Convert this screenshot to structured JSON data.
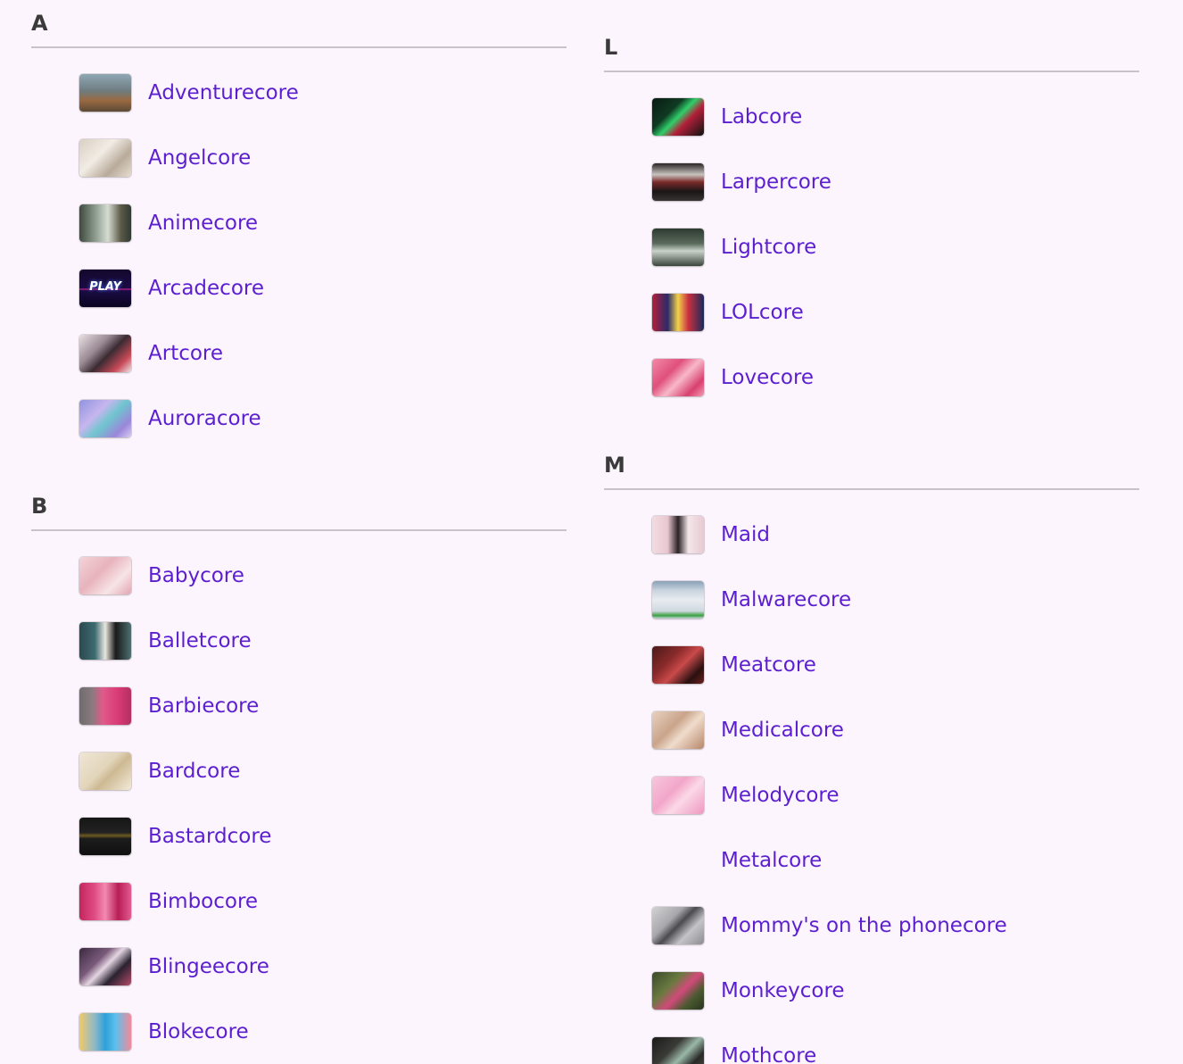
{
  "sections": {
    "A": {
      "letter": "A",
      "items": [
        {
          "label": "Adventurecore",
          "thumb": "linear-gradient(180deg,#8fa7b4 0%,#6e7c80 45%,#9a6a42 70%,#5c4a36 100%)"
        },
        {
          "label": "Angelcore",
          "thumb": "linear-gradient(135deg,#d9cfc3 0%,#f1ece4 40%,#b9ab9b 70%,#e6ddd0 100%)"
        },
        {
          "label": "Animecore",
          "thumb": "linear-gradient(90deg,#3f4a3d 0%,#8a9a8c 30%,#d6dcd2 55%,#5c5a48 80%,#2f3a33 100%)"
        },
        {
          "label": "Arcadecore",
          "thumb": "linear-gradient(180deg,#14082c 0%,#1a0c44 50%,#c0208a 52%,#1a0c44 56%,#0a0520 100%)",
          "overlay": "PLAY"
        },
        {
          "label": "Artcore",
          "thumb": "linear-gradient(135deg,#e9e1e3 0%,#9a8a93 35%,#3a2b33 55%,#c84a58 80%,#efe6e8 100%)"
        },
        {
          "label": "Auroracore",
          "thumb": "linear-gradient(135deg,#8f93e0 0%,#c7b6ee 35%,#6fc5cf 55%,#9b86d9 80%,#d7cdf3 100%)"
        }
      ]
    },
    "B": {
      "letter": "B",
      "items": [
        {
          "label": "Babycore",
          "thumb": "linear-gradient(135deg,#f3d4d8 0%,#e8b3bd 40%,#f7e4e6 70%,#e2a6b2 100%)"
        },
        {
          "label": "Balletcore",
          "thumb": "linear-gradient(90deg,#2a4a50 0%,#3c6b70 30%,#e9e6df 50%,#1a1a1a 70%,#4d6f72 100%)"
        },
        {
          "label": "Barbiecore",
          "thumb": "linear-gradient(90deg,#6d6d6d 0%,#8a7a80 25%,#e05a8a 45%,#d93a75 75%,#b23063 100%)"
        },
        {
          "label": "Bardcore",
          "thumb": "linear-gradient(135deg,#efe6d4 0%,#e2d5bb 45%,#cdb992 60%,#f2ead9 100%)"
        },
        {
          "label": "Bastardcore",
          "thumb": "linear-gradient(180deg,#161616 0%,#222222 40%,#6b5a20 48%,#1c1c1c 56%,#101010 100%)"
        },
        {
          "label": "Bimbocore",
          "thumb": "linear-gradient(90deg,#c4245d 0%,#e04d86 30%,#f28ab0 50%,#b81e56 75%,#e25a91 100%)"
        },
        {
          "label": "Blingeecore",
          "thumb": "linear-gradient(135deg,#3a2a40 0%,#7a5a7a 35%,#e4d6e2 50%,#2a2230 70%,#b44c6a 100%)"
        },
        {
          "label": "Blokecore",
          "thumb": "linear-gradient(90deg,#f2c96a 0%,#8db8c9 30%,#2ea0d9 50%,#5cc0ec 70%,#f18a9a 100%)"
        }
      ]
    },
    "L": {
      "letter": "L",
      "items": [
        {
          "label": "Labcore",
          "thumb": "linear-gradient(135deg,#0a1a12 0%,#0f3a22 35%,#2fcf6a 50%,#b3203a 65%,#0a1410 100%)"
        },
        {
          "label": "Larpercore",
          "thumb": "linear-gradient(180deg,#2a2626 0%,#c9c3bf 30%,#7a2a2a 50%,#1a1616 75%,#3a3434 100%)"
        },
        {
          "label": "Lightcore",
          "thumb": "linear-gradient(180deg,#2e3a30 0%,#5a6a5c 40%,#c9d2c9 60%,#3a463c 100%)"
        },
        {
          "label": "LOLcore",
          "thumb": "linear-gradient(90deg,#b3203a 0%,#2a2a6a 30%,#f2d24a 50%,#c93040 70%,#1a2a5a 100%)"
        },
        {
          "label": "Lovecore",
          "thumb": "linear-gradient(135deg,#f28aa8 0%,#e0507c 35%,#f7b8c9 55%,#d8406e 80%,#f59ab4 100%)"
        }
      ]
    },
    "M": {
      "letter": "M",
      "items": [
        {
          "label": "Maid",
          "thumb": "linear-gradient(90deg,#f2dce2 0%,#e9c6d0 30%,#2a2226 50%,#f4e6ea 70%,#e7c9d2 100%)"
        },
        {
          "label": "Malwarecore",
          "thumb": "linear-gradient(180deg,#8aa0b8 0%,#c9d4de 25%,#e8ecf0 50%,#cfd8e0 80%,#3aa040 92%,#c9d4de 100%)"
        },
        {
          "label": "Meatcore",
          "thumb": "linear-gradient(135deg,#4a1a1a 0%,#8a2a2a 35%,#c94a4a 55%,#2a1010 80%,#6a2020 100%)"
        },
        {
          "label": "Medicalcore",
          "thumb": "linear-gradient(135deg,#e8d2c2 0%,#c9a48a 40%,#f0dccc 60%,#b8866a 100%)"
        },
        {
          "label": "Melodycore",
          "thumb": "linear-gradient(135deg,#f7c6dc 0%,#f2a6c9 40%,#fbd8e8 60%,#ee98bf 100%)"
        },
        {
          "label": "Metalcore",
          "thumb": ""
        },
        {
          "label": "Mommy's on the phonecore",
          "thumb": "linear-gradient(135deg,#d2d2d4 0%,#a8a8ac 35%,#4a4a50 50%,#c4c4c8 70%,#8a8a90 100%)"
        },
        {
          "label": "Monkeycore",
          "thumb": "linear-gradient(135deg,#3a4a2a 0%,#6a7a40 35%,#d24a7a 55%,#4a5a30 75%,#2a3420 100%)"
        },
        {
          "label": "Mothcore",
          "thumb": "linear-gradient(135deg,#1a1a1a 0%,#3a3a36 35%,#9ab8a8 55%,#2a2a28 75%,#4a4a44 100%)"
        }
      ]
    }
  }
}
